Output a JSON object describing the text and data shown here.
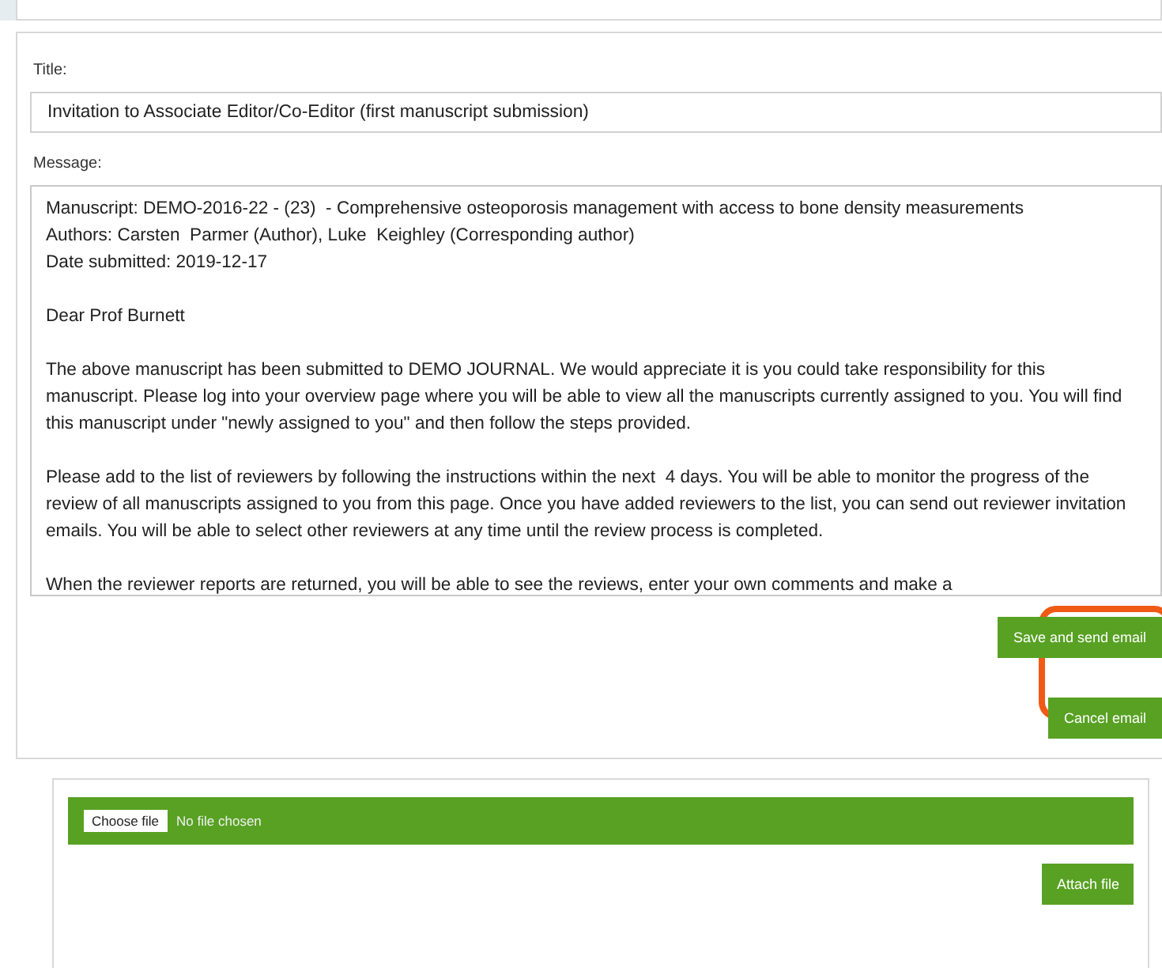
{
  "email_form": {
    "title_label": "Title:",
    "title_value": "Invitation to Associate Editor/Co-Editor (first manuscript submission)",
    "message_label": "Message:",
    "message_paragraphs": [
      "Manuscript: DEMO-2016-22 - (23)  - Comprehensive osteoporosis management with access to bone density measurements\nAuthors: Carsten  Parmer (Author), Luke  Keighley (Corresponding author)\nDate submitted: 2019-12-17",
      "Dear Prof Burnett",
      "The above manuscript has been submitted to DEMO JOURNAL. We would appreciate it is you could take responsibility for this manuscript. Please log into your overview page where you will be able to view all the manuscripts currently assigned to you. You will find this manuscript under \"newly assigned to you\" and then follow the steps provided.",
      "Please add to the list of reviewers by following the instructions within the next  4 days. You will be able to monitor the progress of the review of all manuscripts assigned to you from this page. Once you have added reviewers to the list, you can send out reviewer invitation emails. You will be able to select other reviewers at any time until the review process is completed.",
      "When the reviewer reports are returned, you will be able to see the reviews, enter your own comments and make a"
    ],
    "buttons": [
      "Save and send email",
      "Cancel email"
    ],
    "highlight": true
  },
  "attachment": {
    "choose_button": "Choose file",
    "file_status": "No file chosen",
    "attach_button": "Attach file"
  }
}
